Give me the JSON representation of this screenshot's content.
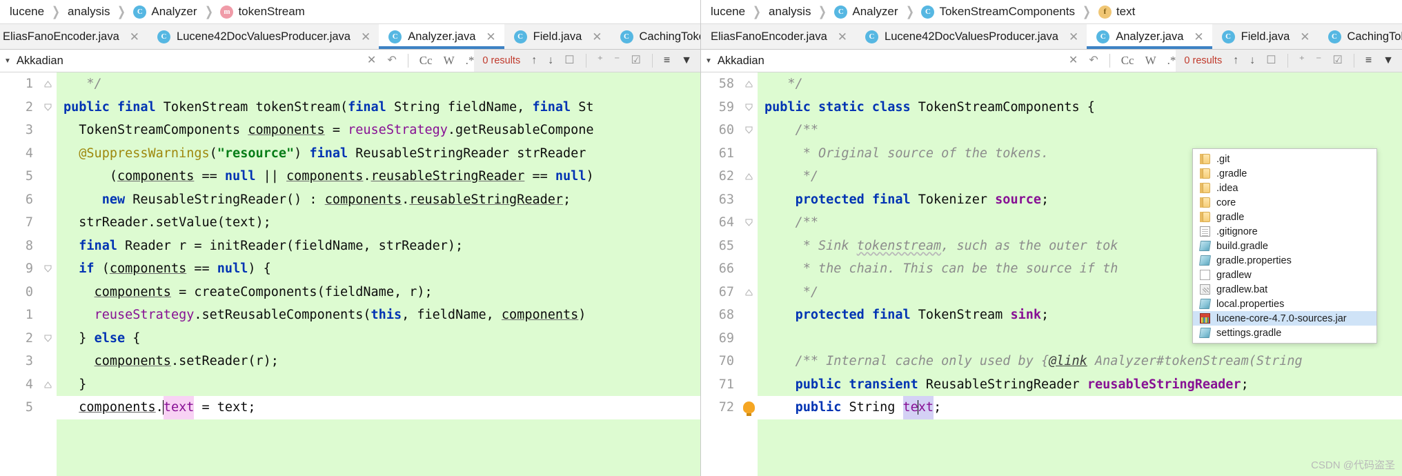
{
  "left": {
    "breadcrumb": [
      {
        "label": "lucene",
        "icon": null
      },
      {
        "label": "analysis",
        "icon": null
      },
      {
        "label": "Analyzer",
        "icon": "class-icon"
      },
      {
        "label": "tokenStream",
        "icon": "method-icon"
      }
    ],
    "tabs": [
      {
        "label": "EliasFanoEncoder.java",
        "icon": null,
        "active": false,
        "closable": true
      },
      {
        "label": "Lucene42DocValuesProducer.java",
        "icon": "class-icon",
        "active": false,
        "closable": true
      },
      {
        "label": "Analyzer.java",
        "icon": "class-icon",
        "active": true,
        "closable": true
      },
      {
        "label": "Field.java",
        "icon": "class-icon",
        "active": false,
        "closable": true
      },
      {
        "label": "CachingToke",
        "icon": "class-icon",
        "active": false,
        "closable": false
      }
    ],
    "find": {
      "value": "Akkadian",
      "results": "0 results",
      "case_label": "Cc",
      "words_label": "W",
      "regex_label": ".*"
    },
    "line_numbers": [
      "1",
      "2",
      "3",
      "4",
      "5",
      "6",
      "7",
      "8",
      "9",
      "0",
      "1",
      "2",
      "3",
      "4",
      "5"
    ]
  },
  "right": {
    "breadcrumb": [
      {
        "label": "lucene",
        "icon": null
      },
      {
        "label": "analysis",
        "icon": null
      },
      {
        "label": "Analyzer",
        "icon": "class-icon"
      },
      {
        "label": "TokenStreamComponents",
        "icon": "class-icon"
      },
      {
        "label": "text",
        "icon": "field-icon"
      }
    ],
    "tabs": [
      {
        "label": "EliasFanoEncoder.java",
        "icon": null,
        "active": false,
        "closable": true
      },
      {
        "label": "Lucene42DocValuesProducer.java",
        "icon": "class-icon",
        "active": false,
        "closable": true
      },
      {
        "label": "Analyzer.java",
        "icon": "class-icon",
        "active": true,
        "closable": true
      },
      {
        "label": "Field.java",
        "icon": "class-icon",
        "active": false,
        "closable": true
      },
      {
        "label": "CachingToke",
        "icon": "class-icon",
        "active": false,
        "closable": false
      }
    ],
    "find": {
      "value": "Akkadian",
      "results": "0 results",
      "case_label": "Cc",
      "words_label": "W",
      "regex_label": ".*"
    },
    "line_numbers": [
      "58",
      "59",
      "60",
      "61",
      "62",
      "63",
      "64",
      "65",
      "66",
      "67",
      "68",
      "69",
      "70",
      "71",
      "72"
    ]
  },
  "popup": {
    "items": [
      {
        "label": ".git",
        "icon": "folder-icon",
        "selected": false
      },
      {
        "label": ".gradle",
        "icon": "folder-icon",
        "selected": false
      },
      {
        "label": ".idea",
        "icon": "folder-icon",
        "selected": false
      },
      {
        "label": "core",
        "icon": "folder-icon",
        "selected": false
      },
      {
        "label": "gradle",
        "icon": "folder-icon",
        "selected": false
      },
      {
        "label": ".gitignore",
        "icon": "document-icon",
        "selected": false
      },
      {
        "label": "build.gradle",
        "icon": "gradle-file-icon",
        "selected": false
      },
      {
        "label": "gradle.properties",
        "icon": "gradle-file-icon",
        "selected": false
      },
      {
        "label": "gradlew",
        "icon": "blank-file-icon",
        "selected": false
      },
      {
        "label": "gradlew.bat",
        "icon": "bat-file-icon",
        "selected": false
      },
      {
        "label": "local.properties",
        "icon": "gradle-file-icon",
        "selected": false
      },
      {
        "label": "lucene-core-4.7.0-sources.jar",
        "icon": "jar-file-icon",
        "selected": true
      },
      {
        "label": "settings.gradle",
        "icon": "gradle-file-icon",
        "selected": false
      }
    ]
  },
  "watermark": "CSDN @代码盗圣",
  "colors": {
    "keyword": "#0033b3",
    "string": "#067d17",
    "annotation": "#9e880d",
    "field": "#871094",
    "comment": "#8c8c8c",
    "diff_added_bg": "#ddfbd1",
    "active_tab_underline": "#3d82c4",
    "results_text": "#c0392b",
    "selection": "#cfe3f7"
  }
}
